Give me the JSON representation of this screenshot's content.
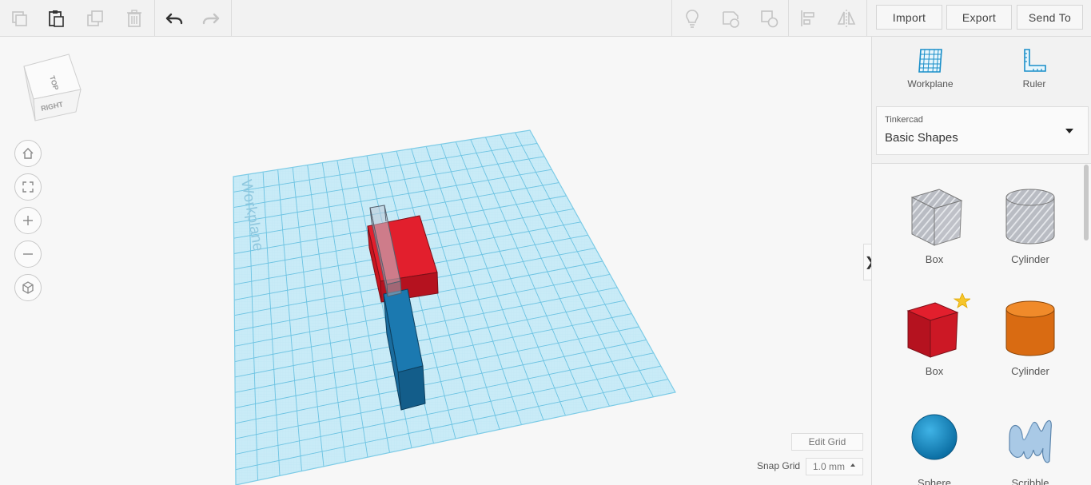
{
  "toolbar": {
    "import_label": "Import",
    "export_label": "Export",
    "send_to_label": "Send To"
  },
  "viewcube": {
    "top_label": "TOP",
    "right_label": "RIGHT"
  },
  "workplane": {
    "watermark": "Workplane"
  },
  "grid_controls": {
    "edit_grid_label": "Edit Grid",
    "snap_grid_label": "Snap Grid",
    "snap_value": "1.0 mm"
  },
  "panel": {
    "workplane_label": "Workplane",
    "ruler_label": "Ruler",
    "library_source": "Tinkercad",
    "library_name": "Basic Shapes",
    "collapse_glyph": "❯",
    "shapes": [
      {
        "label": "Box",
        "style": "hole"
      },
      {
        "label": "Cylinder",
        "style": "hole"
      },
      {
        "label": "Box",
        "style": "solid",
        "color": "#d9202c"
      },
      {
        "label": "Cylinder",
        "style": "solid",
        "color": "#e5761a"
      },
      {
        "label": "Sphere",
        "style": "solid",
        "color": "#1a8fc9"
      },
      {
        "label": "Scribble",
        "style": "solid",
        "color": "#a9c9e6"
      }
    ]
  },
  "colors": {
    "accent": "#1a8fc9",
    "grid": "#8fd0ea",
    "red_box": "#e21f2d",
    "blue_box": "#1b79b0"
  }
}
